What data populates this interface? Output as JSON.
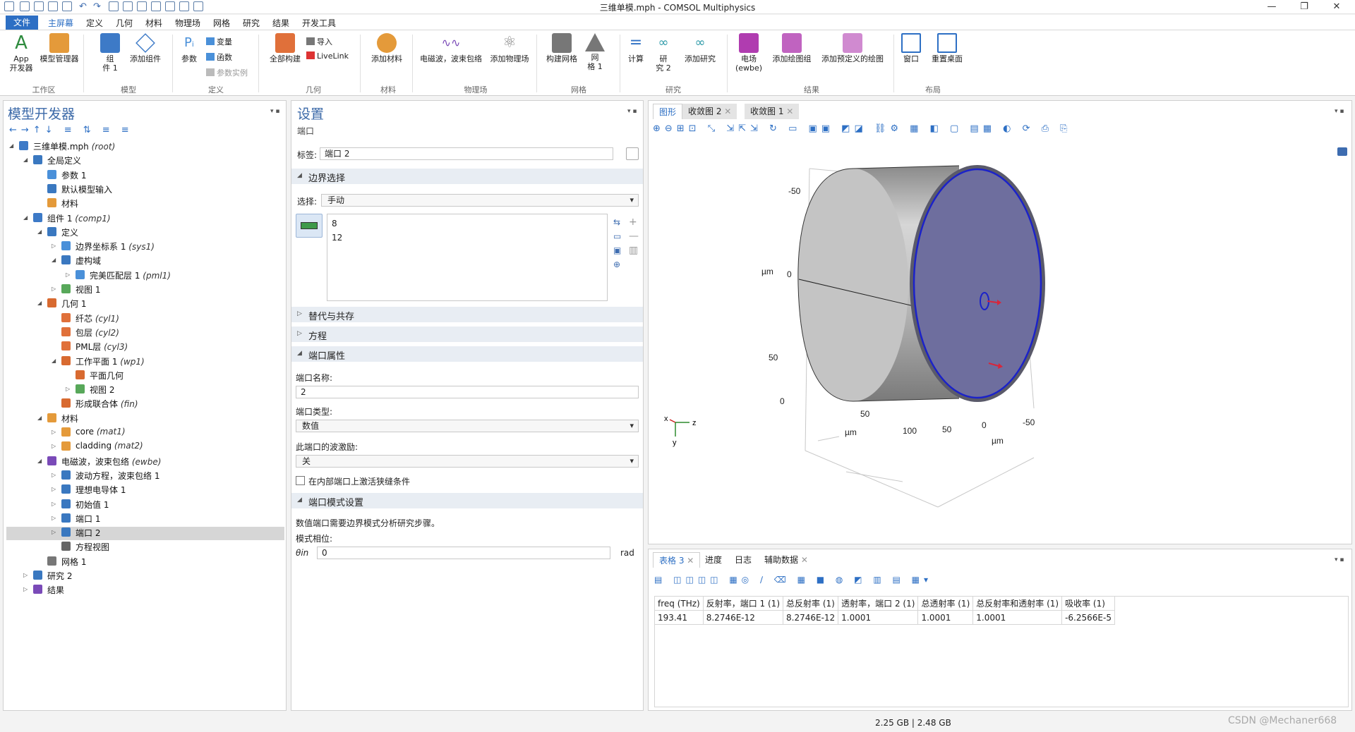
{
  "app": {
    "title": "三维单模.mph - COMSOL Multiphysics",
    "memory": "2.25 GB | 2.48 GB",
    "watermark": "CSDN @Mechaner668"
  },
  "window_controls": {
    "min": "—",
    "max": "❐",
    "close": "✕"
  },
  "menu": {
    "file": "文件",
    "items": [
      "主屏幕",
      "定义",
      "几何",
      "材料",
      "物理场",
      "网格",
      "研究",
      "结果",
      "开发工具"
    ]
  },
  "ribbon": {
    "app_dev": "App\n开发器",
    "model_mgr": "模型管理器",
    "component": "组\n件 1",
    "add_component": "添加组件",
    "param": "参数",
    "variables": "变量",
    "functions": "函数",
    "param_case": "参数实例",
    "build_all": "全部构建",
    "import": "导入",
    "livelink": "LiveLink",
    "add_material": "添加材料",
    "physics_ewbe": "电磁波，波束包络",
    "add_physics": "添加物理场",
    "build_mesh": "构建网格",
    "mesh1": "网\n格 1",
    "compute": "计算",
    "study2": "研\n究 2",
    "add_study": "添加研究",
    "field_ewbe": "电场\n(ewbe)",
    "add_plot_group": "添加绘图组",
    "add_predef_plot": "添加预定义的绘图",
    "window": "窗口",
    "reset_desktop": "重置桌面",
    "groups": [
      "工作区",
      "模型",
      "定义",
      "几何",
      "材料",
      "物理场",
      "网格",
      "研究",
      "结果",
      "布局"
    ]
  },
  "model_builder": {
    "title": "模型开发器",
    "tree": [
      {
        "label": "三维单模.mph",
        "tag": "(root)",
        "level": 0,
        "toggle": "◢",
        "color": "#3d7ac7"
      },
      {
        "label": "全局定义",
        "tag": "",
        "level": 1,
        "toggle": "◢",
        "color": "#3a78c0"
      },
      {
        "label": "参数 1",
        "tag": "",
        "level": 2,
        "toggle": "",
        "color": "#4a90d9"
      },
      {
        "label": "默认模型输入",
        "tag": "",
        "level": 2,
        "toggle": "",
        "color": "#3a78c0"
      },
      {
        "label": "材料",
        "tag": "",
        "level": 2,
        "toggle": "",
        "color": "#e49a3a"
      },
      {
        "label": "组件 1",
        "tag": "(comp1)",
        "level": 1,
        "toggle": "◢",
        "color": "#3d7ac7"
      },
      {
        "label": "定义",
        "tag": "",
        "level": 2,
        "toggle": "◢",
        "color": "#3a78c0"
      },
      {
        "label": "边界坐标系 1",
        "tag": "(sys1)",
        "level": 3,
        "toggle": "▷",
        "color": "#4a90d9"
      },
      {
        "label": "虚构域",
        "tag": "",
        "level": 3,
        "toggle": "◢",
        "color": "#3a78c0"
      },
      {
        "label": "完美匹配层 1",
        "tag": "(pml1)",
        "level": 4,
        "toggle": "▷",
        "color": "#4a90d9"
      },
      {
        "label": "视图 1",
        "tag": "",
        "level": 3,
        "toggle": "▷",
        "color": "#58a85a"
      },
      {
        "label": "几何 1",
        "tag": "",
        "level": 2,
        "toggle": "◢",
        "color": "#d86a30"
      },
      {
        "label": "纤芯",
        "tag": "(cyl1)",
        "level": 3,
        "toggle": "",
        "color": "#e0703a"
      },
      {
        "label": "包层",
        "tag": "(cyl2)",
        "level": 3,
        "toggle": "",
        "color": "#e0703a"
      },
      {
        "label": "PML层",
        "tag": "(cyl3)",
        "level": 3,
        "toggle": "",
        "color": "#e0703a"
      },
      {
        "label": "工作平面 1",
        "tag": "(wp1)",
        "level": 3,
        "toggle": "◢",
        "color": "#d86a30"
      },
      {
        "label": "平面几何",
        "tag": "",
        "level": 4,
        "toggle": "",
        "color": "#d86a30"
      },
      {
        "label": "视图 2",
        "tag": "",
        "level": 4,
        "toggle": "▷",
        "color": "#58a85a"
      },
      {
        "label": "形成联合体",
        "tag": "(fin)",
        "level": 3,
        "toggle": "",
        "color": "#d86a30"
      },
      {
        "label": "材料",
        "tag": "",
        "level": 2,
        "toggle": "◢",
        "color": "#e49a3a"
      },
      {
        "label": "core",
        "tag": "(mat1)",
        "level": 3,
        "toggle": "▷",
        "color": "#e49a3a"
      },
      {
        "label": "cladding",
        "tag": "(mat2)",
        "level": 3,
        "toggle": "▷",
        "color": "#e49a3a"
      },
      {
        "label": "电磁波，波束包络",
        "tag": "(ewbe)",
        "level": 2,
        "toggle": "◢",
        "color": "#7a4ab8"
      },
      {
        "label": "波动方程，波束包络 1",
        "tag": "",
        "level": 3,
        "toggle": "▷",
        "color": "#3a78c0"
      },
      {
        "label": "理想电导体 1",
        "tag": "",
        "level": 3,
        "toggle": "▷",
        "color": "#3a78c0"
      },
      {
        "label": "初始值 1",
        "tag": "",
        "level": 3,
        "toggle": "▷",
        "color": "#3a78c0"
      },
      {
        "label": "端口 1",
        "tag": "",
        "level": 3,
        "toggle": "▷",
        "color": "#3a78c0"
      },
      {
        "label": "端口 2",
        "tag": "",
        "level": 3,
        "toggle": "▷",
        "color": "#3a78c0",
        "selected": true
      },
      {
        "label": "方程视图",
        "tag": "",
        "level": 3,
        "toggle": "",
        "color": "#666"
      },
      {
        "label": "网格 1",
        "tag": "",
        "level": 2,
        "toggle": "",
        "color": "#777"
      },
      {
        "label": "研究 2",
        "tag": "",
        "level": 1,
        "toggle": "▷",
        "color": "#3a78c0"
      },
      {
        "label": "结果",
        "tag": "",
        "level": 1,
        "toggle": "▷",
        "color": "#7a4ab8"
      }
    ]
  },
  "settings": {
    "title": "设置",
    "subtitle": "端口",
    "label_label": "标签:",
    "label_value": "端口 2",
    "boundary_section": "边界选择",
    "selection_label": "选择:",
    "selection_value": "手动",
    "boundaries": [
      "8",
      "12"
    ],
    "override_section": "替代与共存",
    "equation_section": "方程",
    "port_props_section": "端口属性",
    "port_name_label": "端口名称:",
    "port_name_value": "2",
    "port_type_label": "端口类型:",
    "port_type_value": "数值",
    "wave_exc_label": "此端口的波激励:",
    "wave_exc_value": "关",
    "internal_port_label": "在内部端口上激活狭缝条件",
    "mode_section": "端口模式设置",
    "mode_note": "数值端口需要边界模式分析研究步骤。",
    "mode_phase_label": "模式相位:",
    "theta_label": "θin",
    "theta_value": "0",
    "theta_unit": "rad"
  },
  "graphics": {
    "tabs": [
      "图形",
      "收敛图 2",
      "收敛图 1"
    ],
    "axis_labels": {
      "y_ticks": [
        "-50",
        "0",
        "50",
        "0"
      ],
      "x_ticks": [
        "50",
        "100",
        "50",
        "0",
        "-50"
      ],
      "unit_left": "µm",
      "unit_bottom1": "µm",
      "unit_bottom2": "µm",
      "axes": [
        "x",
        "z",
        "y"
      ]
    }
  },
  "bottom": {
    "tabs": [
      "表格 3",
      "进度",
      "日志",
      "辅助数据"
    ],
    "table": {
      "headers": [
        "freq (THz)",
        "反射率，端口 1 (1)",
        "总反射率 (1)",
        "透射率，端口 2 (1)",
        "总透射率 (1)",
        "总反射率和透射率 (1)",
        "吸收率 (1)"
      ],
      "rows": [
        [
          "193.41",
          "8.2746E-12",
          "8.2746E-12",
          "1.0001",
          "1.0001",
          "1.0001",
          "-6.2566E-5"
        ]
      ]
    }
  },
  "colors": {
    "accent": "#2d6fc4",
    "port_face": "#6e6e9e",
    "port_edge": "#1b22c9",
    "arrow": "#d8263b"
  }
}
